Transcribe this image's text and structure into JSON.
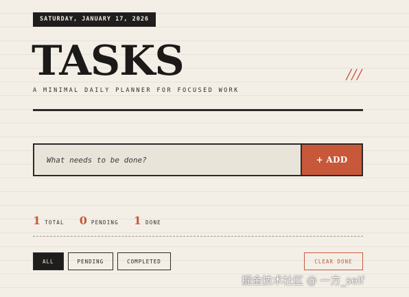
{
  "header": {
    "date": "SATURDAY, JANUARY 17, 2026",
    "title": "TASKS",
    "decoration": "///",
    "subtitle": "A MINIMAL DAILY PLANNER FOR FOCUSED WORK"
  },
  "form": {
    "input_value": "",
    "input_placeholder": "What needs to be done?",
    "add_label": "+ ADD"
  },
  "stats": {
    "total": {
      "value": "1",
      "label": "TOTAL"
    },
    "pending": {
      "value": "0",
      "label": "PENDING"
    },
    "done": {
      "value": "1",
      "label": "DONE"
    }
  },
  "filters": {
    "items": [
      {
        "label": "ALL",
        "active": true
      },
      {
        "label": "PENDING",
        "active": false
      },
      {
        "label": "COMPLETED",
        "active": false
      }
    ],
    "clear_label": "CLEAR DONE"
  },
  "watermark": "掘金技术社区 @ 一方_self",
  "colors": {
    "background": "#f3efe7",
    "ink": "#1f1e1c",
    "accent": "#c7583a",
    "input_background": "#e8e4da"
  }
}
